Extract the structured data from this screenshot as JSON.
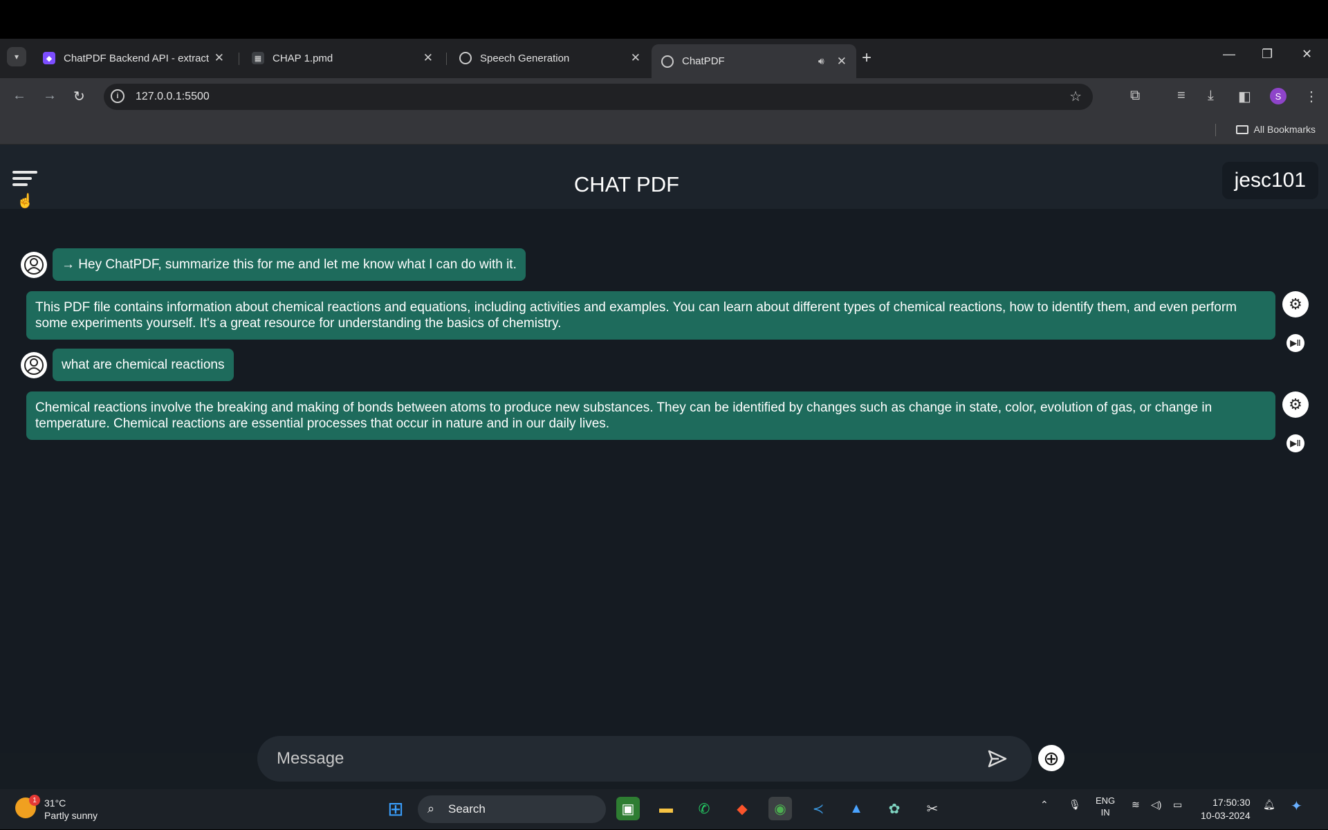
{
  "browser": {
    "tabs": [
      {
        "title": "ChatPDF Backend API - extract",
        "close": "✕"
      },
      {
        "title": "CHAP 1.pmd",
        "close": "✕"
      },
      {
        "title": "Speech Generation",
        "close": "✕"
      },
      {
        "title": "ChatPDF",
        "close": "✕"
      }
    ],
    "new_tab": "+",
    "url": "127.0.0.1:5500",
    "bookmarks_label": "All Bookmarks",
    "profile_initial": "S"
  },
  "app": {
    "title": "CHAT PDF",
    "file_name": "jesc101",
    "messages": [
      {
        "role": "user",
        "text": "→ Hey ChatPDF, summarize this for me and let me know what I can do with it."
      },
      {
        "role": "bot",
        "text": "This PDF file contains information about chemical reactions and equations, including activities and examples. You can learn about different types of chemical reactions, how to identify them, and even perform some experiments yourself. It's a great resource for understanding the basics of chemistry."
      },
      {
        "role": "user",
        "text": "what are chemical reactions"
      },
      {
        "role": "bot",
        "text": "Chemical reactions involve the breaking and making of bonds between atoms to produce new substances. They can be identified by changes such as change in state, color, evolution of gas, or change in temperature. Chemical reactions are essential processes that occur in nature and in our daily lives."
      }
    ],
    "composer": {
      "placeholder": "Message"
    }
  },
  "taskbar": {
    "weather_temp": "31°C",
    "weather_desc": "Partly sunny",
    "weather_badge": "1",
    "search_label": "Search",
    "lang_top": "ENG",
    "lang_bottom": "IN",
    "time": "17:50:30",
    "date": "10-03-2024"
  },
  "colors": {
    "bubble": "#1e6b5c",
    "app_bg": "#151b22",
    "header_bg": "#1c232b"
  }
}
